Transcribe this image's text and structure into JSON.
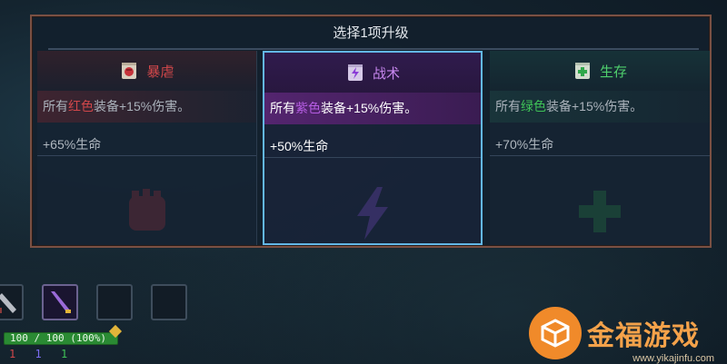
{
  "panel": {
    "title": "选择1项升级"
  },
  "cards": [
    {
      "name": "暴虐",
      "icon": "red-fist-scroll-icon",
      "desc_prefix": "所有",
      "desc_color_word": "红色",
      "desc_suffix": "装备+15%伤害。",
      "stat": "+65%生命",
      "color": "#d0474a",
      "selected": false
    },
    {
      "name": "战术",
      "icon": "purple-lightning-scroll-icon",
      "desc_prefix": "所有",
      "desc_color_word": "紫色",
      "desc_suffix": "装备+15%伤害。",
      "stat": "+50%生命",
      "color": "#b65de3",
      "selected": true
    },
    {
      "name": "生存",
      "icon": "green-cross-scroll-icon",
      "desc_prefix": "所有",
      "desc_color_word": "绿色",
      "desc_suffix": "装备+15%伤害。",
      "stat": "+70%生命",
      "color": "#3fc257",
      "selected": false
    }
  ],
  "hud": {
    "hp_text": "100 / 100 (100%)",
    "counters": [
      "1",
      "1",
      "1"
    ],
    "counter_colors": [
      "#d0474a",
      "#7b6cf0",
      "#3fc257"
    ]
  },
  "watermark": {
    "brand": "金福游戏",
    "url": "www.yikajinfu.com"
  }
}
